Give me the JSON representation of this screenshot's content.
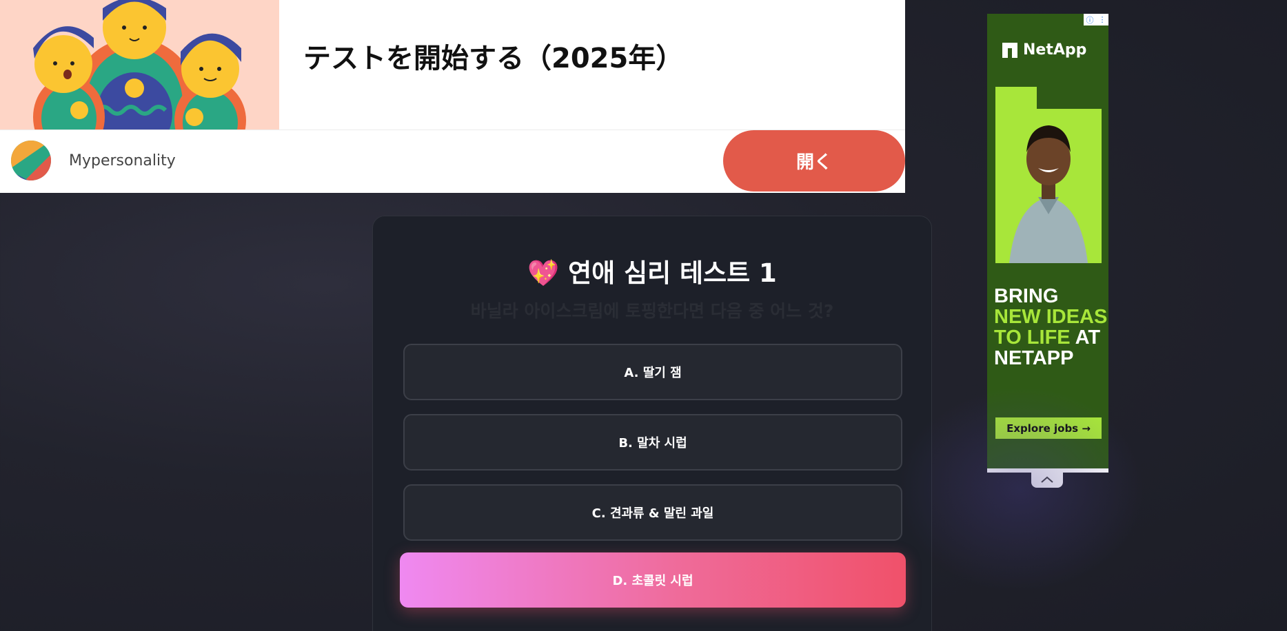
{
  "top_ad": {
    "headline": "テストを開始する（2025年）",
    "brand": "Mypersonality",
    "cta_label": "開く"
  },
  "side_ad": {
    "info_icon": "info-icon",
    "menu_icon": "more-vert-icon",
    "logo_text": "NetApp",
    "tagline_line1": "BRING",
    "tagline_line2": "NEW IDEAS",
    "tagline_line3": "TO LIFE",
    "tagline_line3b": " AT",
    "tagline_line4": "NETAPP",
    "cta_label": "Explore jobs →",
    "accent_color": "#a8e63a",
    "background_color": "#2f5a16",
    "collapse_icon": "chevron-up-icon"
  },
  "quiz": {
    "title": "💖 연애 심리 테스트 1",
    "question": "바닐라 아이스크림에 토핑한다면 다음 중 어느 것?",
    "options": [
      {
        "label": "A. 딸기 잼"
      },
      {
        "label": "B. 말차 시럽"
      },
      {
        "label": "C. 견과류 & 말린 과일"
      },
      {
        "label": "D. 초콜릿 시럽",
        "selected": true
      }
    ]
  }
}
